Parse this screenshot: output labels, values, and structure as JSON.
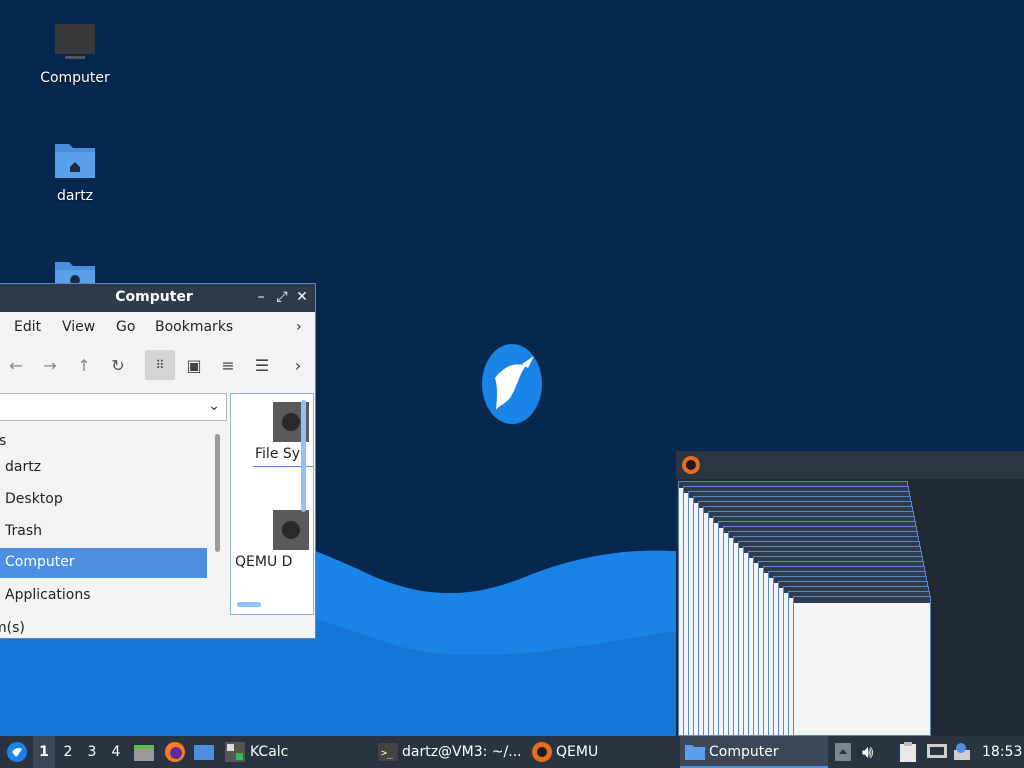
{
  "desktop": {
    "icons": [
      {
        "label": "Computer",
        "icon": "computer-icon"
      },
      {
        "label": "dartz",
        "icon": "home-folder-icon"
      },
      {
        "label": "",
        "icon": "network-folder-icon"
      }
    ]
  },
  "file_manager": {
    "title": "Computer",
    "menu": [
      "Edit",
      "View",
      "Go",
      "Bookmarks"
    ],
    "menu_more": "›",
    "sidebar_header": "s",
    "sidebar_items": [
      "dartz",
      "Desktop",
      "Trash",
      "Computer",
      "Applications"
    ],
    "selected_item": "Computer",
    "content_items": [
      "File Sy",
      "QEMU D"
    ],
    "status": "m(s)"
  },
  "taskbar": {
    "workspaces": [
      "1",
      "2",
      "3",
      "4"
    ],
    "current_workspace": "1",
    "tasks": [
      {
        "label": "KCalc",
        "icon": "kcalc-icon"
      },
      {
        "label": "dartz@VM3: ~/...",
        "icon": "terminal-icon"
      },
      {
        "label": "QEMU",
        "icon": "qemu-icon"
      },
      {
        "label": "Computer",
        "icon": "folder-icon"
      }
    ],
    "clock": "18:53"
  },
  "colors": {
    "desktop_bg": "#06284e",
    "wave": "#1a84e6",
    "taskbar": "#2a3441",
    "accent": "#4d8fe0"
  }
}
